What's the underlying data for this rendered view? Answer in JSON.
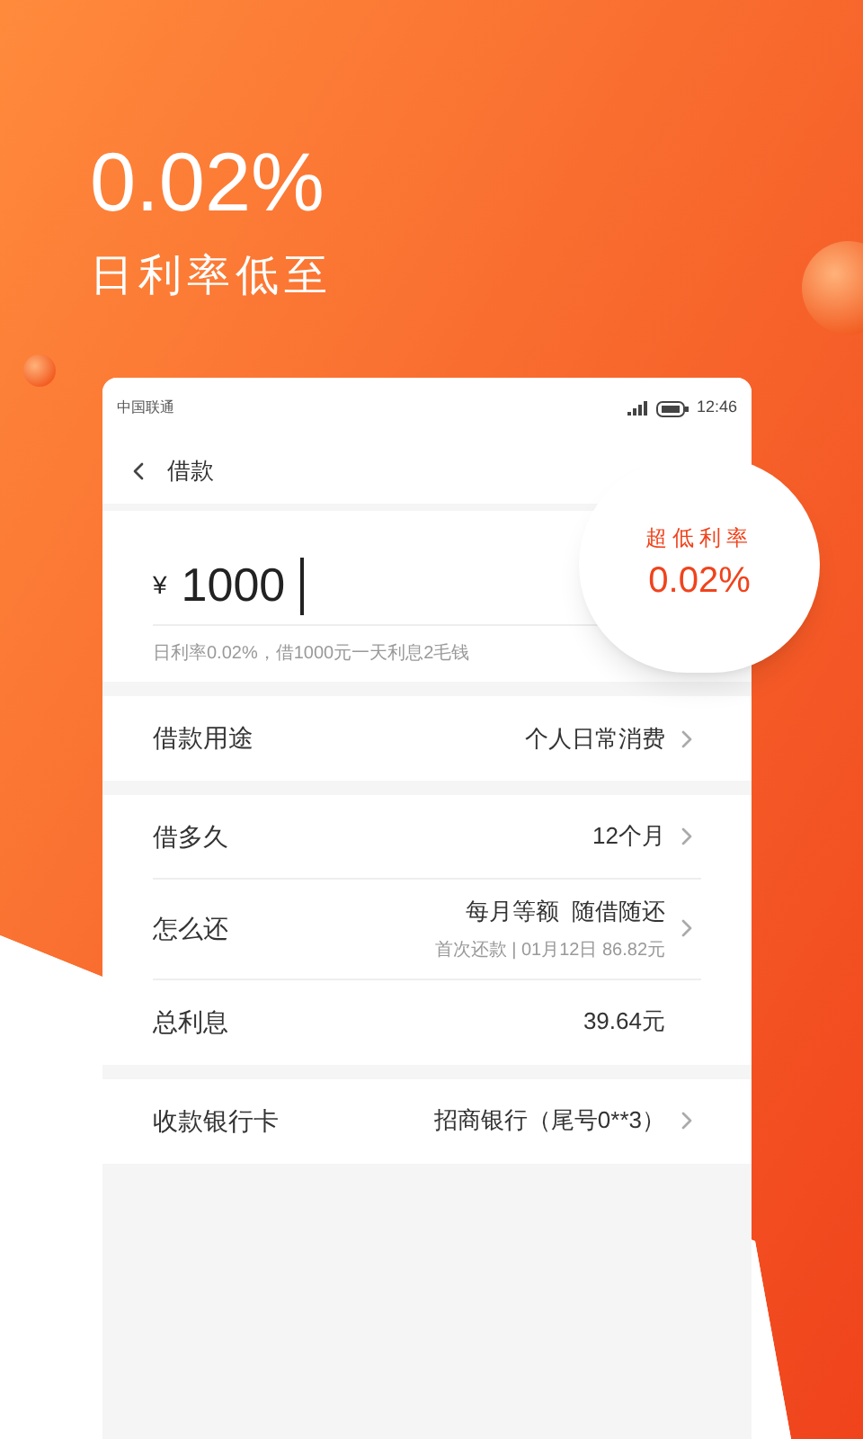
{
  "hero": {
    "rate": "0.02%",
    "caption": "日利率低至"
  },
  "phone": {
    "status_bar": {
      "carrier": "中国联通",
      "time": "12:46"
    },
    "nav": {
      "title": "借款"
    },
    "amount": {
      "currency": "¥",
      "value": "1000"
    },
    "note": "日利率0.02%，借1000元一天利息2毛钱",
    "bubble": {
      "label": "超低利率",
      "rate": "0.02%"
    },
    "groups": [
      [
        {
          "label": "借款用途",
          "value": "个人日常消费",
          "chevron": true
        }
      ],
      [
        {
          "label": "借多久",
          "value": "12个月",
          "chevron": true
        },
        {
          "label": "怎么还",
          "value": "每月等额  随借随还",
          "subvalue": "首次还款 | 01月12日 86.82元",
          "chevron": true
        },
        {
          "label": "总利息",
          "value": "39.64元",
          "chevron": false
        }
      ],
      [
        {
          "label": "收款银行卡",
          "value": "招商银行（尾号0**3）",
          "chevron": true
        }
      ]
    ]
  }
}
